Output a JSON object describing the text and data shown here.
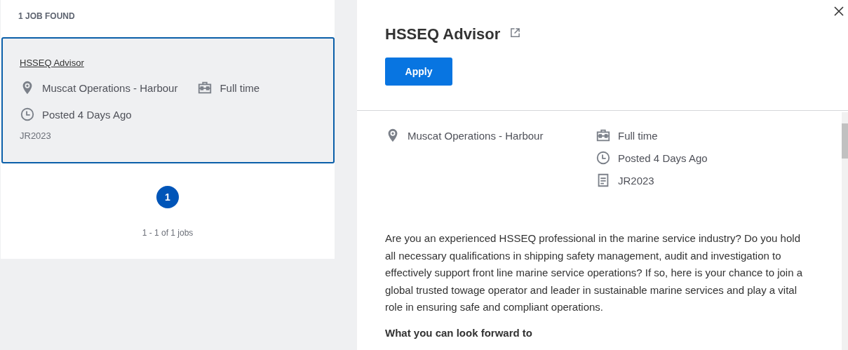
{
  "results_count": "1 JOB FOUND",
  "jobs": [
    {
      "title": "HSSEQ Advisor",
      "selected": true,
      "location": "Muscat Operations - Harbour",
      "time_type": "Full time",
      "posted": "Posted 4 Days Ago",
      "id": "JR2023"
    }
  ],
  "pagination": {
    "pages": [
      {
        "label": "1",
        "selected": true
      }
    ],
    "summary": "1 - 1 of 1 jobs"
  },
  "detail": {
    "title": "HSSEQ Advisor",
    "apply": "Apply",
    "location": "Muscat Operations - Harbour",
    "time_type": "Full time",
    "posted": "Posted 4 Days Ago",
    "requisition": "JR2023",
    "description": "Are you an experienced HSSEQ professional in the marine service industry? Do you hold all necessary qualifications in shipping safety management, audit and investigation to effectively support front line marine service operations? If so, here is your chance to join a global trusted towage operator and leader in sustainable marine services and play a vital role in ensuring safe and compliant operations.",
    "section_heading": "What you can look forward to"
  }
}
